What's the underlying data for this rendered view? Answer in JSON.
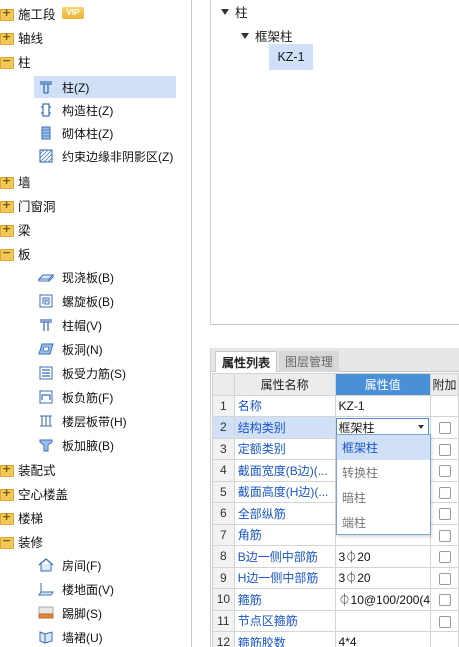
{
  "left_tree": {
    "vip_badge": "VIP",
    "categories": {
      "shigongduan": "施工段",
      "zhouxian": "轴线",
      "zhu": "柱",
      "qiang": "墙",
      "menchuangdong": "门窗洞",
      "liang": "梁",
      "ban": "板",
      "zhuangpeishi": "装配式",
      "kongxinlougai": "空心楼盖",
      "louti": "楼梯",
      "zhuangxiu": "装修"
    },
    "zhu_items": [
      "柱(Z)",
      "构造柱(Z)",
      "砌体柱(Z)",
      "约束边缘非阴影区(Z)"
    ],
    "ban_items": [
      "现浇板(B)",
      "螺旋板(B)",
      "柱帽(V)",
      "板洞(N)",
      "板受力筋(S)",
      "板负筋(F)",
      "楼层板带(H)",
      "板加腋(B)"
    ],
    "zhuangxiu_items": [
      "房间(F)",
      "楼地面(V)",
      "踢脚(S)",
      "墙裙(U)"
    ]
  },
  "component_tree": {
    "root": "柱",
    "child": "框架柱",
    "leaf": "KZ-1"
  },
  "tabs": [
    "属性列表",
    "图层管理"
  ],
  "prop_table": {
    "headers": [
      "属性名称",
      "属性值",
      "附加"
    ],
    "rows": [
      {
        "num": "1",
        "name": "名称",
        "value": "KZ-1"
      },
      {
        "num": "2",
        "name": "结构类别",
        "value": "框架柱"
      },
      {
        "num": "3",
        "name": "定额类别",
        "value": ""
      },
      {
        "num": "4",
        "name": "截面宽度(B边)(...",
        "value": ""
      },
      {
        "num": "5",
        "name": "截面高度(H边)(...",
        "value": ""
      },
      {
        "num": "6",
        "name": "全部纵筋",
        "value": ""
      },
      {
        "num": "7",
        "name": "角筋",
        "value": ""
      },
      {
        "num": "8",
        "name": "B边一侧中部筋",
        "value": "3⏀20"
      },
      {
        "num": "9",
        "name": "H边一侧中部筋",
        "value": "3⏀20"
      },
      {
        "num": "10",
        "name": "箍筋",
        "value": "⏀10@100/200(4"
      },
      {
        "num": "11",
        "name": "节点区箍筋",
        "value": ""
      },
      {
        "num": "12",
        "name": "箍筋胶数",
        "value": "4*4"
      }
    ]
  },
  "dropdown_options": [
    "框架柱",
    "转换柱",
    "暗柱",
    "端柱"
  ],
  "colors": {
    "selection": "#cfe0f7",
    "header_value": "#4a90d9",
    "link_text": "#1a56c9",
    "folder": "#f0c85a"
  }
}
